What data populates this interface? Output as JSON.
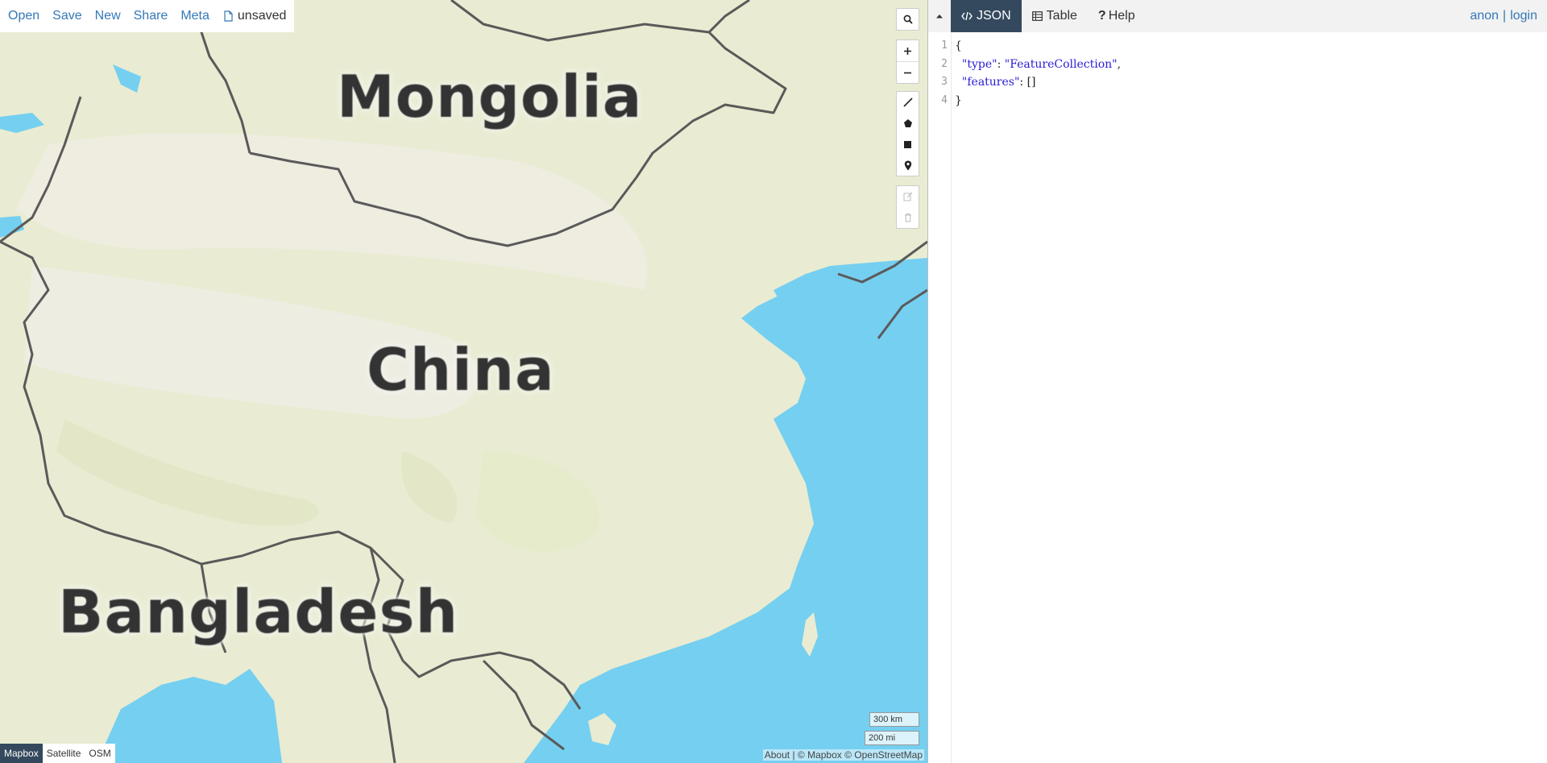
{
  "toolbar": {
    "open": "Open",
    "save": "Save",
    "new": "New",
    "share": "Share",
    "meta": "Meta",
    "file_status": "unsaved"
  },
  "map": {
    "labels": {
      "mongolia": "Mongolia",
      "china": "China",
      "bangladesh": "Bangladesh"
    },
    "scale": {
      "km": "300 km",
      "mi": "200 mi"
    },
    "attribution": "About | © Mapbox © OpenStreetMap",
    "layers": [
      "Mapbox",
      "Satellite",
      "OSM"
    ],
    "active_layer": "Mapbox",
    "colors": {
      "land": "#e9ecd2",
      "water": "#75cff0",
      "border": "#5a5a5a"
    }
  },
  "panel": {
    "tabs": {
      "json": "JSON",
      "table": "Table",
      "help": "Help"
    },
    "active_tab": "JSON",
    "user": {
      "anon": "anon",
      "separator": "|",
      "login": "login"
    },
    "editor": {
      "line_numbers": [
        "1",
        "2",
        "3",
        "4"
      ],
      "line1": "{",
      "line2_key": "\"type\"",
      "line2_colon": ": ",
      "line2_value": "\"FeatureCollection\"",
      "line2_comma": ",",
      "line3_key": "\"features\"",
      "line3_rest": ": []",
      "line4": "}"
    }
  }
}
